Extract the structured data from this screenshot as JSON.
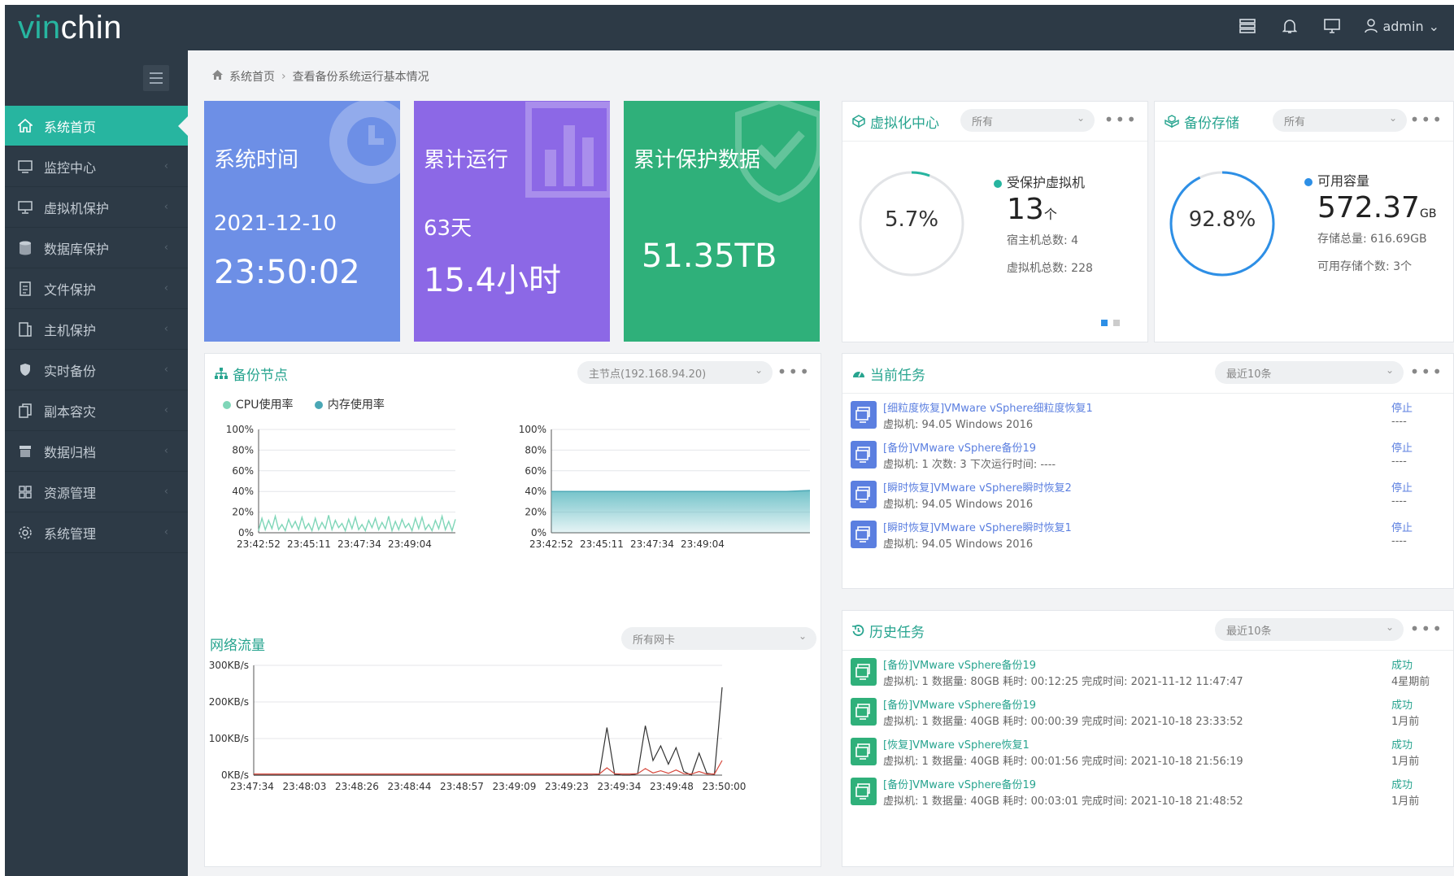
{
  "app": {
    "logo_vin": "vin",
    "logo_chin": "chin",
    "user": "admin"
  },
  "sidebar": {
    "items": [
      {
        "label": "系统首页",
        "icon": "home-icon",
        "active": true
      },
      {
        "label": "监控中心",
        "icon": "monitor-icon"
      },
      {
        "label": "虚拟机保护",
        "icon": "vm-icon"
      },
      {
        "label": "数据库保护",
        "icon": "database-icon"
      },
      {
        "label": "文件保护",
        "icon": "file-icon"
      },
      {
        "label": "主机保护",
        "icon": "host-icon"
      },
      {
        "label": "实时备份",
        "icon": "shield-icon"
      },
      {
        "label": "副本容灾",
        "icon": "copy-icon"
      },
      {
        "label": "数据归档",
        "icon": "archive-icon"
      },
      {
        "label": "资源管理",
        "icon": "grid-icon"
      },
      {
        "label": "系统管理",
        "icon": "gear-icon"
      }
    ]
  },
  "breadcrumb": {
    "home": "系统首页",
    "current": "查看备份系统运行基本情况"
  },
  "stats": {
    "time": {
      "title": "系统时间",
      "date": "2021-12-10",
      "time": "23:50:02",
      "color": "#6d8fe6"
    },
    "uptime": {
      "title": "累计运行",
      "days": "63天",
      "hours": "15.4小时",
      "color": "#8c68e6"
    },
    "protected": {
      "title": "累计保护数据",
      "value": "51.35TB",
      "color": "#2fb07a"
    }
  },
  "virtual": {
    "title": "虚拟化中心",
    "filter": "所有",
    "percent": "5.7%",
    "percent_value": 5.7,
    "label": "受保护虚拟机",
    "count": "13",
    "unit": "个",
    "hosts": "宿主机总数: 4",
    "vms": "虚拟机总数: 228"
  },
  "storage": {
    "title": "备份存储",
    "filter": "所有",
    "percent": "92.8%",
    "percent_value": 92.8,
    "label": "可用容量",
    "value": "572.37",
    "unit": "GB",
    "total": "存储总量: 616.69GB",
    "count": "可用存储个数: 3个"
  },
  "nodes": {
    "title": "备份节点",
    "filter": "主节点(192.168.94.20)",
    "legend_cpu": "CPU使用率",
    "legend_mem": "内存使用率",
    "y_ticks": [
      "100%",
      "80%",
      "60%",
      "40%",
      "20%",
      "0%"
    ],
    "x_ticks": [
      "23:42:52",
      "23:45:11",
      "23:47:34",
      "23:49:04"
    ]
  },
  "network": {
    "title": "网络流量",
    "filter": "所有网卡",
    "y_ticks": [
      "300KB/s",
      "200KB/s",
      "100KB/s",
      "0KB/s"
    ],
    "x_ticks": [
      "23:47:34",
      "23:48:03",
      "23:48:26",
      "23:48:44",
      "23:48:57",
      "23:49:09",
      "23:49:23",
      "23:49:34",
      "23:49:48",
      "23:50:00"
    ]
  },
  "chart_data": [
    {
      "type": "line",
      "title": "CPU使用率",
      "ylim": [
        0,
        100
      ],
      "x": [
        "23:42:52",
        "23:45:11",
        "23:47:34",
        "23:49:04"
      ],
      "series": [
        {
          "name": "CPU使用率",
          "values": [
            2,
            14,
            3,
            12,
            4,
            16,
            3,
            8,
            2,
            13,
            5,
            11,
            3,
            15,
            4,
            9,
            2,
            14,
            3,
            10,
            4,
            17,
            3,
            12,
            5,
            9,
            2,
            13,
            4,
            15,
            3,
            8,
            2,
            12,
            5,
            14,
            3,
            10,
            4,
            16,
            2,
            11,
            3,
            13,
            5,
            9,
            2,
            14,
            4,
            15,
            3,
            8,
            2,
            12,
            4,
            16,
            3,
            11,
            2,
            13
          ]
        }
      ]
    },
    {
      "type": "area",
      "title": "内存使用率",
      "ylim": [
        0,
        100
      ],
      "x": [
        "23:42:52",
        "23:45:11",
        "23:47:34",
        "23:49:04"
      ],
      "series": [
        {
          "name": "内存使用率",
          "values": [
            40,
            40,
            40,
            40,
            40,
            40,
            40,
            40,
            40,
            40,
            40,
            41
          ]
        }
      ]
    },
    {
      "type": "line",
      "title": "网络流量",
      "ylim": [
        0,
        300
      ],
      "x": [
        "23:47:34",
        "23:48:03",
        "23:48:26",
        "23:48:44",
        "23:48:57",
        "23:49:09",
        "23:49:23",
        "23:49:34",
        "23:49:48",
        "23:50:00"
      ],
      "series": [
        {
          "values": [
            0,
            0,
            0,
            0,
            0,
            0,
            0,
            0,
            0,
            0,
            0,
            0,
            0,
            0,
            0,
            0,
            0,
            0,
            0,
            0,
            0,
            0,
            0,
            0,
            0,
            0,
            0,
            0,
            0,
            0,
            0,
            0,
            0,
            0,
            0,
            0,
            0,
            0,
            0,
            0,
            0,
            0,
            0,
            0,
            0,
            1,
            130,
            2,
            0,
            0,
            4,
            135,
            40,
            80,
            30,
            75,
            10,
            0,
            60,
            5,
            2,
            240
          ]
        },
        {
          "values": [
            3,
            3,
            3,
            3,
            3,
            3,
            3,
            3,
            3,
            3,
            3,
            3,
            3,
            3,
            3,
            3,
            3,
            3,
            3,
            3,
            3,
            3,
            3,
            3,
            3,
            3,
            3,
            3,
            3,
            3,
            3,
            3,
            3,
            3,
            3,
            3,
            3,
            3,
            3,
            3,
            3,
            3,
            3,
            3,
            3,
            3,
            20,
            4,
            3,
            3,
            4,
            18,
            6,
            12,
            5,
            14,
            4,
            3,
            10,
            3,
            3,
            40
          ]
        }
      ]
    },
    {
      "type": "pie",
      "title": "虚拟化中心",
      "values": [
        5.7,
        94.3
      ]
    },
    {
      "type": "pie",
      "title": "备份存储",
      "values": [
        92.8,
        7.2
      ]
    }
  ],
  "current_tasks": {
    "title": "当前任务",
    "filter": "最近10条",
    "items": [
      {
        "title": "[细粒度恢复]VMware vSphere细粒度恢复1",
        "sub": "虚拟机: 94.05 Windows 2016",
        "action": "停止",
        "extra": "----"
      },
      {
        "title": "[备份]VMware vSphere备份19",
        "sub": "虚拟机: 1 次数: 3 下次运行时间: ----",
        "action": "停止",
        "extra": "----"
      },
      {
        "title": "[瞬时恢复]VMware vSphere瞬时恢复2",
        "sub": "虚拟机: 94.05 Windows 2016",
        "action": "停止",
        "extra": "----"
      },
      {
        "title": "[瞬时恢复]VMware vSphere瞬时恢复1",
        "sub": "虚拟机: 94.05 Windows 2016",
        "action": "停止",
        "extra": "----"
      }
    ]
  },
  "history_tasks": {
    "title": "历史任务",
    "filter": "最近10条",
    "items": [
      {
        "title": "[备份]VMware vSphere备份19",
        "sub": "虚拟机: 1 数据量: 80GB 耗时: 00:12:25 完成时间: 2021-11-12 11:47:47",
        "status": "成功",
        "when": "4星期前"
      },
      {
        "title": "[备份]VMware vSphere备份19",
        "sub": "虚拟机: 1 数据量: 40GB 耗时: 00:00:39 完成时间: 2021-10-18 23:33:52",
        "status": "成功",
        "when": "1月前"
      },
      {
        "title": "[恢复]VMware vSphere恢复1",
        "sub": "虚拟机: 1 数据量: 40GB 耗时: 00:01:56 完成时间: 2021-10-18 21:56:19",
        "status": "成功",
        "when": "1月前"
      },
      {
        "title": "[备份]VMware vSphere备份19",
        "sub": "虚拟机: 1 数据量: 40GB 耗时: 00:03:01 完成时间: 2021-10-18 21:48:52",
        "status": "成功",
        "when": "1月前"
      }
    ]
  },
  "colors": {
    "accent": "#27b5a0",
    "link": "#5b7fe0",
    "sidebar": "#2d3a46",
    "cpu": "#7fd6b8",
    "mem": "#4aa7b5",
    "net1": "#333333",
    "net2": "#d6473b",
    "ring_blue": "#2d8fe6"
  }
}
